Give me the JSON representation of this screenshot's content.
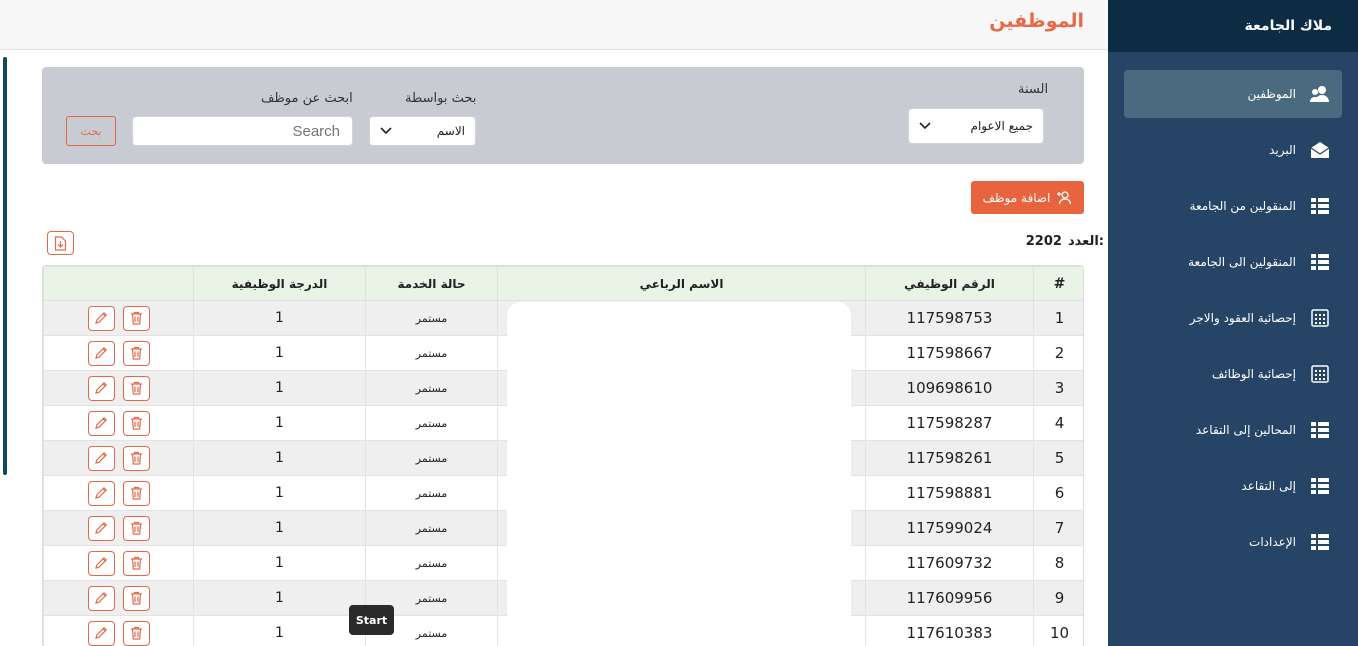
{
  "sidebar": {
    "title": "ملاك الجامعة",
    "items": [
      {
        "label": "الموظفين",
        "icon": "users-icon",
        "active": true
      },
      {
        "label": "البريد",
        "icon": "mail-icon"
      },
      {
        "label": "المنقولين من الجامعة",
        "icon": "list-icon"
      },
      {
        "label": "المنقولين الى الجامعة",
        "icon": "list-icon"
      },
      {
        "label": "إحصائية العقود والاجر",
        "icon": "calendar-icon"
      },
      {
        "label": "إحصائية الوظائف",
        "icon": "calendar-icon"
      },
      {
        "label": "المحالين إلى التقاعد",
        "icon": "list-icon"
      },
      {
        "label": "إلى التقاعد",
        "icon": "list-icon"
      },
      {
        "label": "الإعدادات",
        "icon": "list-icon"
      }
    ]
  },
  "header": {
    "title": "الموظفين"
  },
  "filters": {
    "year_label": "السنة",
    "year_value": "جميع الاعوام",
    "search_by_label": "بحث بواسطة",
    "search_by_value": "الاسم",
    "search_employee_label": "ابحث عن موظف",
    "search_placeholder": "Search",
    "search_button": "بحث"
  },
  "actions": {
    "add_employee": "اضافة موظف"
  },
  "count": {
    "label": "العدد:",
    "value": "2202"
  },
  "table": {
    "headers": {
      "index": "#",
      "job_id": "الرقم الوظيفي",
      "name": "الاسم الرباعي",
      "status": "حالة الخدمة",
      "grade": "الدرجة الوظيفية"
    },
    "rows": [
      {
        "index": "1",
        "job_id": "117598753",
        "status": "مستمر",
        "grade": "1"
      },
      {
        "index": "2",
        "job_id": "117598667",
        "status": "مستمر",
        "grade": "1"
      },
      {
        "index": "3",
        "job_id": "109698610",
        "status": "مستمر",
        "grade": "1"
      },
      {
        "index": "4",
        "job_id": "117598287",
        "status": "مستمر",
        "grade": "1"
      },
      {
        "index": "5",
        "job_id": "117598261",
        "status": "مستمر",
        "grade": "1"
      },
      {
        "index": "6",
        "job_id": "117598881",
        "status": "مستمر",
        "grade": "1"
      },
      {
        "index": "7",
        "job_id": "117599024",
        "status": "مستمر",
        "grade": "1"
      },
      {
        "index": "8",
        "job_id": "117609732",
        "status": "مستمر",
        "grade": "1"
      },
      {
        "index": "9",
        "job_id": "117609956",
        "status": "مستمر",
        "grade": "1"
      },
      {
        "index": "10",
        "job_id": "117610383",
        "status": "مستمر",
        "grade": "1"
      }
    ]
  },
  "tooltip": {
    "start": "Start"
  },
  "colors": {
    "accent": "#e8643f",
    "sidebar": "#254466",
    "sidebar_header": "#0c2c44",
    "table_header": "#eaf4e6"
  }
}
